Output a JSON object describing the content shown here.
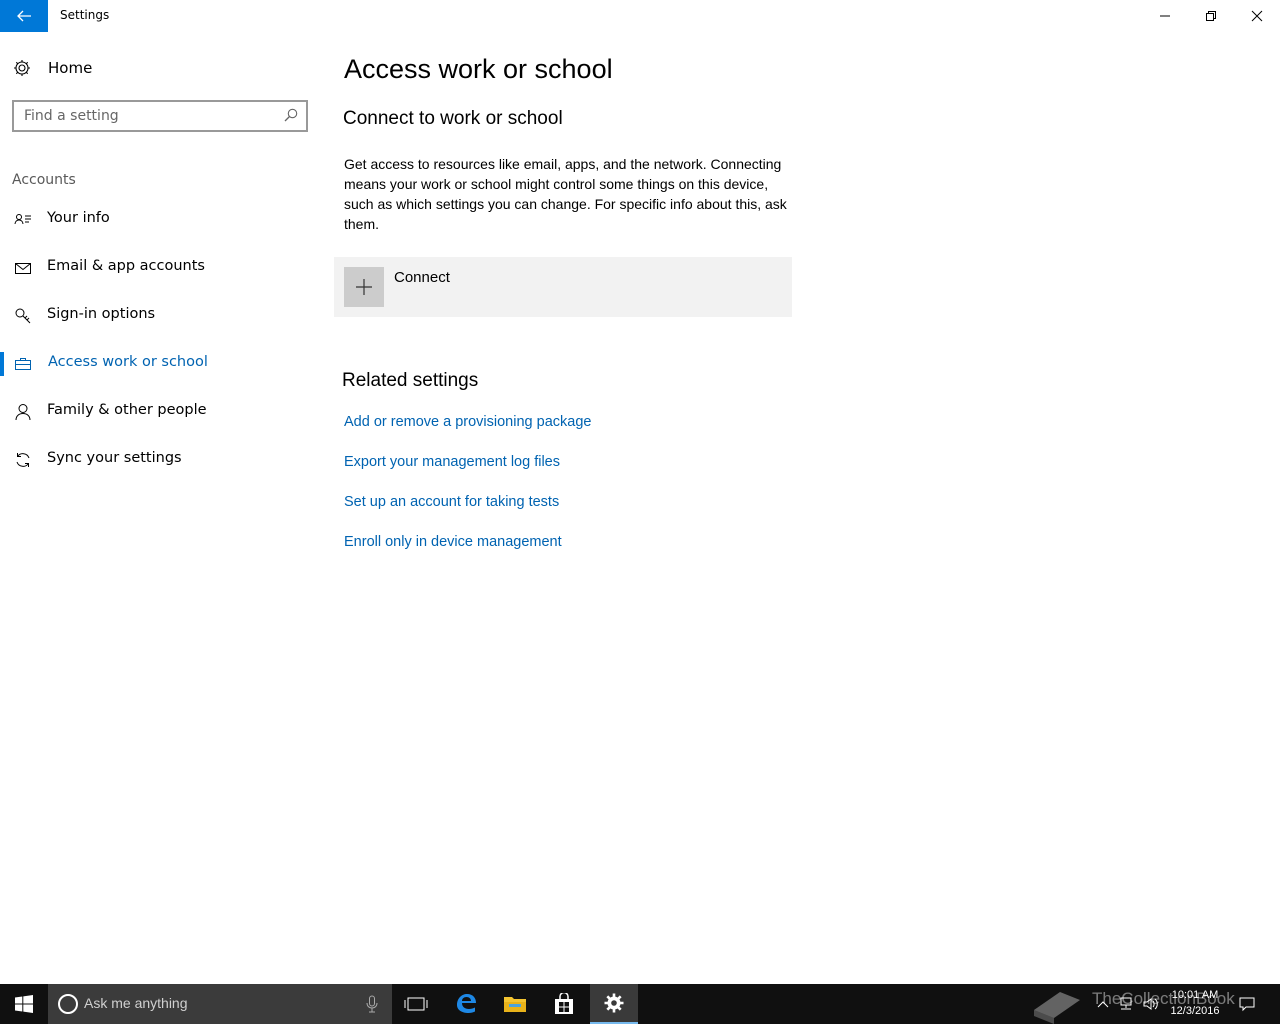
{
  "window": {
    "title": "Settings",
    "controls": {
      "minimize": "minimize-icon",
      "restore": "restore-icon",
      "close": "close-icon"
    }
  },
  "sidebar": {
    "home_label": "Home",
    "search_placeholder": "Find a setting",
    "section_label": "Accounts",
    "items": [
      {
        "label": "Your info",
        "icon": "contact-card-icon",
        "active": false
      },
      {
        "label": "Email & app accounts",
        "icon": "mail-icon",
        "active": false
      },
      {
        "label": "Sign-in options",
        "icon": "key-icon",
        "active": false
      },
      {
        "label": "Access work or school",
        "icon": "briefcase-icon",
        "active": true
      },
      {
        "label": "Family & other people",
        "icon": "person-icon",
        "active": false
      },
      {
        "label": "Sync your settings",
        "icon": "sync-icon",
        "active": false
      }
    ]
  },
  "main": {
    "title": "Access work or school",
    "subtitle": "Connect to work or school",
    "description": "Get access to resources like email, apps, and the network. Connecting means your work or school might control some things on this device, such as which settings you can change. For specific info about this, ask them.",
    "connect_label": "Connect",
    "related_title": "Related settings",
    "related_links": [
      "Add or remove a provisioning package",
      "Export your management log files",
      "Set up an account for taking tests",
      "Enroll only in device management"
    ]
  },
  "taskbar": {
    "search_placeholder": "Ask me anything",
    "time": "10:01 AM",
    "date": "12/3/2016",
    "watermark": "TheCollectionBook"
  },
  "colors": {
    "accent": "#0078d7",
    "link": "#0063b1",
    "taskbar": "#101010"
  }
}
